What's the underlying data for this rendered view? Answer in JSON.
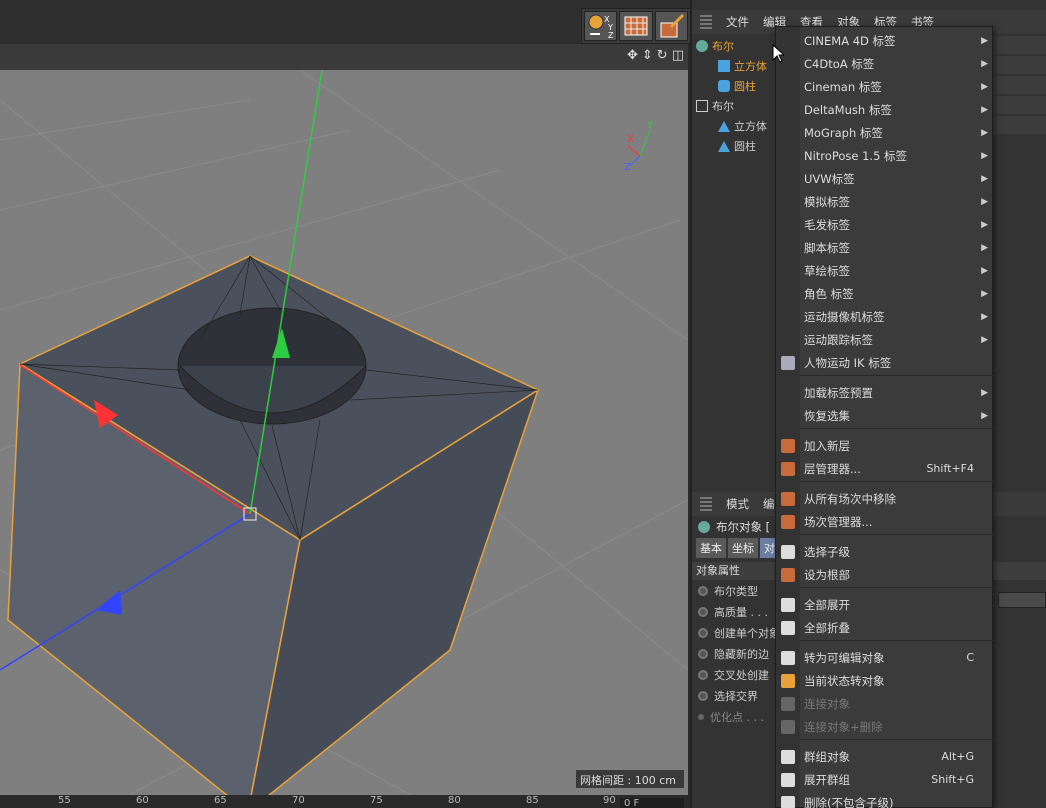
{
  "toolbar": {
    "tools": [
      "coordinate-system-icon",
      "texture-icon",
      "paint-icon"
    ]
  },
  "viewport": {
    "grid_spacing": "网格间距 : 100 cm",
    "axis": {
      "x": "X",
      "y": "Y",
      "z": "Z"
    }
  },
  "ruler": {
    "ticks": [
      "55",
      "60",
      "65",
      "70",
      "75",
      "80",
      "85",
      "90"
    ],
    "field": "0 F"
  },
  "object_manager": {
    "menu": [
      "文件",
      "编辑",
      "查看",
      "对象",
      "标签",
      "书签"
    ],
    "tree": [
      {
        "label": "布尔",
        "level": 0,
        "color": "#e8a23a"
      },
      {
        "label": "立方体",
        "level": 1,
        "color": "#e8a23a"
      },
      {
        "label": "圆柱",
        "level": 1,
        "color": "#e8a23a"
      },
      {
        "label": "布尔",
        "level": 0,
        "color": "#cccccc"
      },
      {
        "label": "立方体",
        "level": 1,
        "color": "#cccccc"
      },
      {
        "label": "圆柱",
        "level": 1,
        "color": "#cccccc"
      }
    ]
  },
  "attribute_manager": {
    "menu": [
      "模式",
      "编辑"
    ],
    "title": "布尔对象 [",
    "tabs": [
      "基本",
      "坐标",
      "对象"
    ],
    "section": "对象属性",
    "rows": [
      {
        "label": "布尔类型",
        "disabled": false
      },
      {
        "label": "高质量 . . .",
        "disabled": false
      },
      {
        "label": "创建单个对象",
        "disabled": false
      },
      {
        "label": "隐藏新的边",
        "disabled": false
      },
      {
        "label": "交叉处创建",
        "disabled": false
      },
      {
        "label": "选择交界",
        "disabled": false
      },
      {
        "label": "优化点 . . .",
        "disabled": true
      }
    ]
  },
  "context_menu": {
    "items": [
      {
        "label": "CINEMA 4D 标签",
        "arrow": true,
        "shortcut": "",
        "disabled": false,
        "icon": ""
      },
      {
        "label": "C4DtoA 标签",
        "arrow": true,
        "shortcut": "",
        "disabled": false,
        "icon": ""
      },
      {
        "label": "Cineman 标签",
        "arrow": true,
        "shortcut": "",
        "disabled": false,
        "icon": ""
      },
      {
        "label": "DeltaMush 标签",
        "arrow": true,
        "shortcut": "",
        "disabled": false,
        "icon": ""
      },
      {
        "label": "MoGraph 标签",
        "arrow": true,
        "shortcut": "",
        "disabled": false,
        "icon": ""
      },
      {
        "label": "NitroPose 1.5 标签",
        "arrow": true,
        "shortcut": "",
        "disabled": false,
        "icon": ""
      },
      {
        "label": "UVW标签",
        "arrow": true,
        "shortcut": "",
        "disabled": false,
        "icon": ""
      },
      {
        "label": "模拟标签",
        "arrow": true,
        "shortcut": "",
        "disabled": false,
        "icon": ""
      },
      {
        "label": "毛发标签",
        "arrow": true,
        "shortcut": "",
        "disabled": false,
        "icon": ""
      },
      {
        "label": "脚本标签",
        "arrow": true,
        "shortcut": "",
        "disabled": false,
        "icon": ""
      },
      {
        "label": "草绘标签",
        "arrow": true,
        "shortcut": "",
        "disabled": false,
        "icon": ""
      },
      {
        "label": "角色 标签",
        "arrow": true,
        "shortcut": "",
        "disabled": false,
        "icon": ""
      },
      {
        "label": "运动摄像机标签",
        "arrow": true,
        "shortcut": "",
        "disabled": false,
        "icon": ""
      },
      {
        "label": "运动跟踪标签",
        "arrow": true,
        "shortcut": "",
        "disabled": false,
        "icon": ""
      },
      {
        "label": "人物运动 IK 标签",
        "arrow": false,
        "shortcut": "",
        "disabled": false,
        "icon": "ik-arrow-icon"
      },
      {
        "label": "加载标签预置",
        "arrow": true,
        "shortcut": "",
        "disabled": false,
        "icon": ""
      },
      {
        "label": "恢复选集",
        "arrow": true,
        "shortcut": "",
        "disabled": false,
        "icon": ""
      },
      {
        "label": "加入新层",
        "arrow": false,
        "shortcut": "",
        "disabled": false,
        "icon": "new-layer-icon"
      },
      {
        "label": "层管理器...",
        "arrow": false,
        "shortcut": "Shift+F4",
        "disabled": false,
        "icon": "layer-manager-icon"
      },
      {
        "label": "从所有场次中移除",
        "arrow": false,
        "shortcut": "",
        "disabled": false,
        "icon": "take-remove-icon"
      },
      {
        "label": "场次管理器...",
        "arrow": false,
        "shortcut": "",
        "disabled": false,
        "icon": "take-manager-icon"
      },
      {
        "label": "选择子级",
        "arrow": false,
        "shortcut": "",
        "disabled": false,
        "icon": "select-children-icon"
      },
      {
        "label": "设为根部",
        "arrow": false,
        "shortcut": "",
        "disabled": false,
        "icon": "set-root-icon"
      },
      {
        "label": "全部展开",
        "arrow": false,
        "shortcut": "",
        "disabled": false,
        "icon": "expand-all-icon"
      },
      {
        "label": "全部折叠",
        "arrow": false,
        "shortcut": "",
        "disabled": false,
        "icon": "collapse-all-icon"
      },
      {
        "label": "转为可编辑对象",
        "arrow": false,
        "shortcut": "C",
        "disabled": false,
        "icon": "make-editable-icon"
      },
      {
        "label": "当前状态转对象",
        "arrow": false,
        "shortcut": "",
        "disabled": false,
        "icon": "current-state-icon"
      },
      {
        "label": "连接对象",
        "arrow": false,
        "shortcut": "",
        "disabled": true,
        "icon": "connect-icon"
      },
      {
        "label": "连接对象+删除",
        "arrow": false,
        "shortcut": "",
        "disabled": true,
        "icon": "connect-delete-icon"
      },
      {
        "label": "群组对象",
        "arrow": false,
        "shortcut": "Alt+G",
        "disabled": false,
        "icon": "group-icon"
      },
      {
        "label": "展开群组",
        "arrow": false,
        "shortcut": "Shift+G",
        "disabled": false,
        "icon": "ungroup-icon"
      },
      {
        "label": "删除(不包含子级)",
        "arrow": false,
        "shortcut": "",
        "disabled": false,
        "icon": "delete-no-children-icon"
      }
    ]
  }
}
